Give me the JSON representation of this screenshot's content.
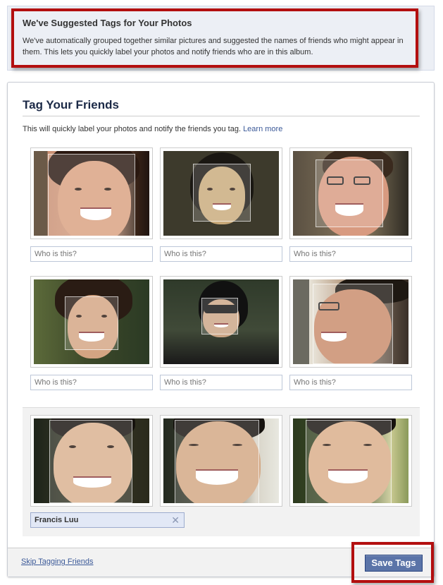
{
  "notice": {
    "title": "We've Suggested Tags for Your Photos",
    "body": "We've automatically grouped together similar pictures and suggested the names of friends who might appear in them. This lets you quickly label your photos and notify friends who are in this album."
  },
  "main": {
    "heading": "Tag Your Friends",
    "description": "This will quickly label your photos and notify the friends you tag.",
    "learn_more": "Learn more",
    "input_placeholder": "Who is this?",
    "group_name": "Francis Luu",
    "remove_glyph": "✕"
  },
  "footer": {
    "skip_label": "Skip Tagging Friends",
    "save_label": "Save Tags"
  },
  "colors": {
    "highlight": "#b30f0f",
    "link": "#3b5998",
    "button": "#5b74a8"
  }
}
